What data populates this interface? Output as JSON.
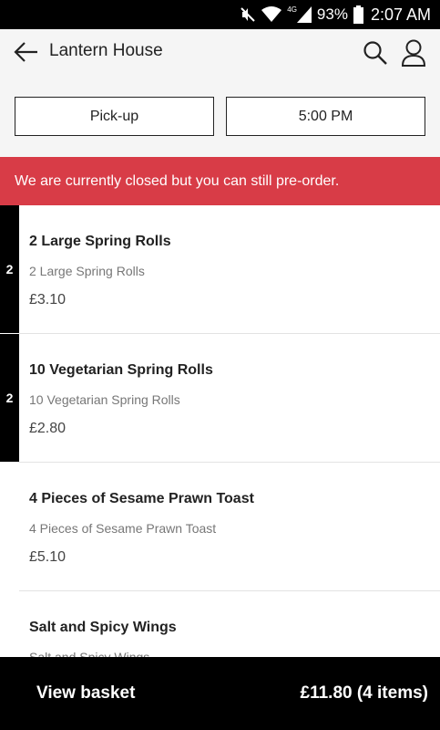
{
  "status_bar": {
    "network": "4G",
    "battery": "93%",
    "time": "2:07 AM"
  },
  "header": {
    "title": "Lantern House",
    "order_type": "Pick-up",
    "order_time": "5:00 PM"
  },
  "banner": {
    "text": "We are currently closed but you can still pre-order."
  },
  "menu": {
    "items": [
      {
        "qty": "2",
        "name": "2 Large Spring Rolls",
        "desc": "2 Large Spring Rolls",
        "price": "£3.10"
      },
      {
        "qty": "2",
        "name": "10 Vegetarian Spring Rolls",
        "desc": "10 Vegetarian Spring Rolls",
        "price": "£2.80"
      },
      {
        "qty": "",
        "name": "4 Pieces of Sesame Prawn Toast",
        "desc": "4 Pieces of Sesame Prawn Toast",
        "price": "£5.10"
      },
      {
        "qty": "",
        "name": "Salt and Spicy Wings",
        "desc": "Salt and Spicy Wings",
        "price": ""
      }
    ]
  },
  "basket": {
    "label": "View basket",
    "total": "£11.80 (4 items)"
  },
  "icons": {
    "back": "arrow-left-icon",
    "search": "search-icon",
    "account": "user-icon"
  },
  "colors": {
    "banner": "#d83c47",
    "qty_bar": "#000000",
    "basket_bar": "#000000"
  }
}
